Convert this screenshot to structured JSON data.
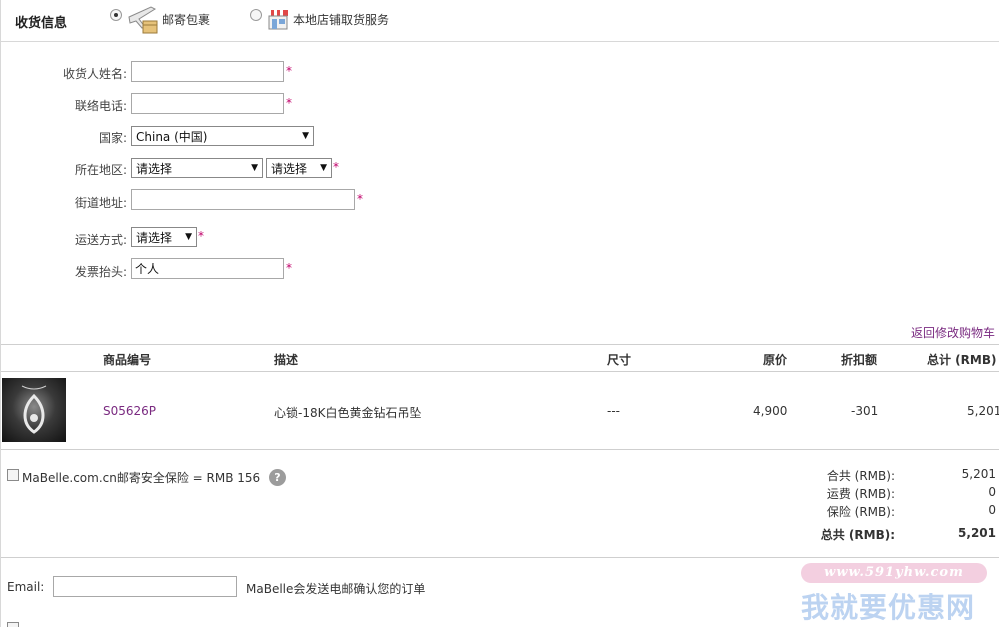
{
  "header": {
    "title": "收货信息",
    "option_mail": "邮寄包裹",
    "option_store": "本地店铺取货服务"
  },
  "form": {
    "name_label": "收货人姓名:",
    "name_value": "",
    "phone_label": "联络电话:",
    "phone_value": "",
    "country_label": "国家:",
    "country_value": "China (中国)",
    "region_label": "所在地区:",
    "region_value_1": "请选择",
    "region_value_2": "请选择",
    "street_label": "街道地址:",
    "street_value": "",
    "shipping_label": "运送方式:",
    "shipping_value": "请选择",
    "invoice_label": "发票抬头:",
    "invoice_value": "个人",
    "required_mark": "*"
  },
  "back_to_cart": "返回修改购物车",
  "table": {
    "headers": {
      "code": "商品编号",
      "desc": "描述",
      "size": "尺寸",
      "price": "原价",
      "discount": "折扣额",
      "total": "总计 (RMB)"
    },
    "rows": [
      {
        "code": "S05626P",
        "desc": "心锁-18K白色黄金钻石吊坠",
        "size": "---",
        "price": "4,900",
        "discount": "-301",
        "total": "5,201"
      }
    ]
  },
  "insurance": {
    "label": "MaBelle.com.cn邮寄安全保险 = RMB 156",
    "help": "?"
  },
  "summary": {
    "subtotal_label": "合共 (RMB):",
    "subtotal_value": "5,201",
    "shipping_label": "运费 (RMB):",
    "shipping_value": "0",
    "insurance_label": "保险 (RMB):",
    "insurance_value": "0",
    "total_label": "总共 (RMB):",
    "total_value": "5,201"
  },
  "email": {
    "label": "Email:",
    "value": "",
    "note": "MaBelle会发送电邮确认您的订单"
  },
  "watermark": {
    "url": "www.591yhw.com",
    "name": "我就要优惠网"
  },
  "colors": {
    "link": "#7a2a80",
    "required": "#c0006a",
    "border": "#cfcfcf"
  }
}
